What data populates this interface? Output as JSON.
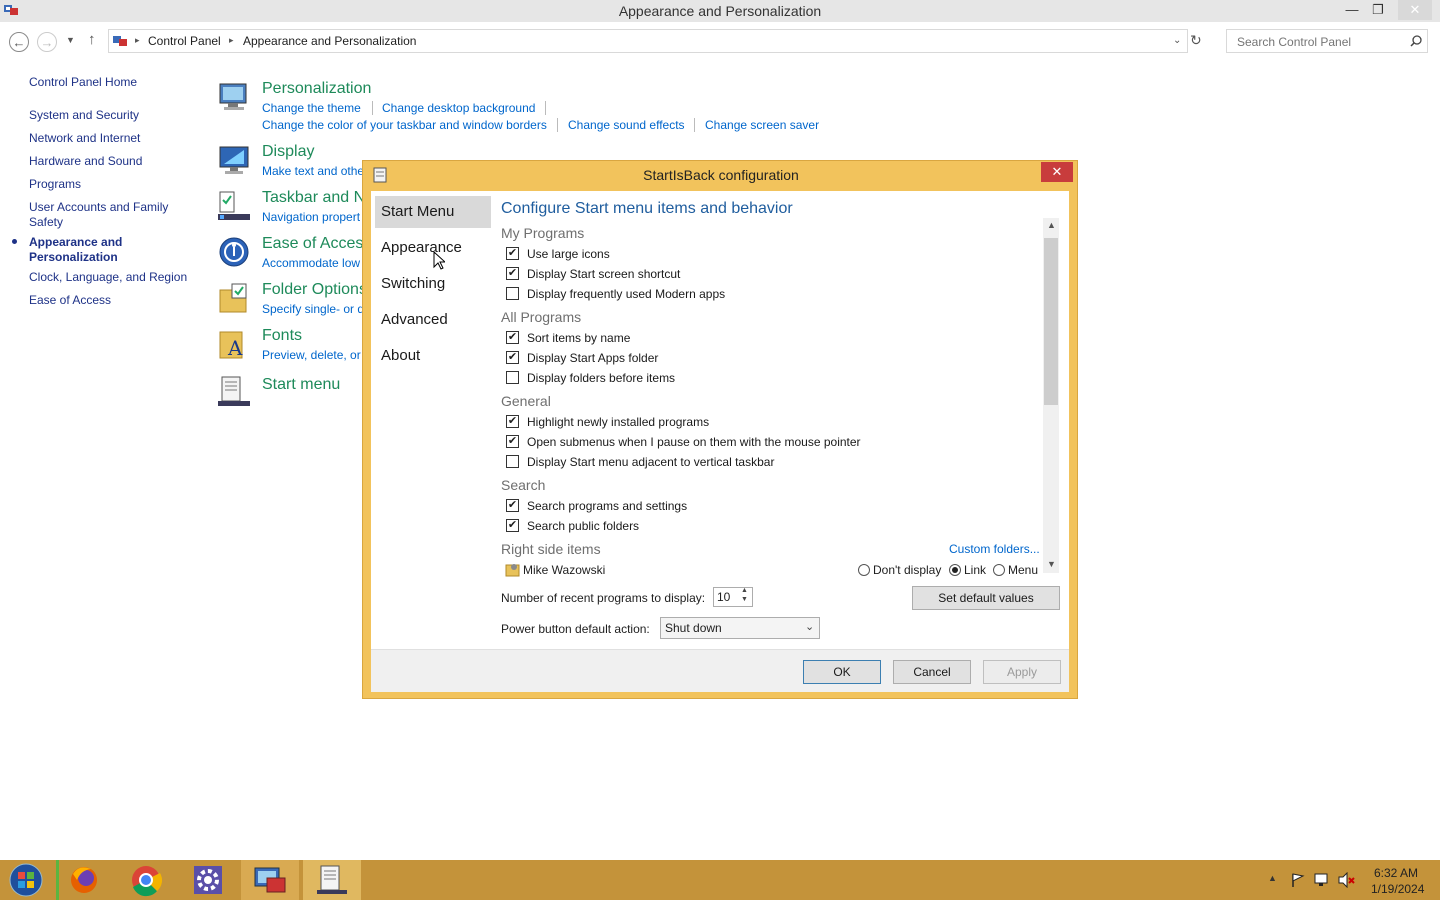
{
  "window": {
    "title": "Appearance and Personalization"
  },
  "address": {
    "breadcrumb": [
      "Control Panel",
      "Appearance and Personalization"
    ],
    "search_placeholder": "Search Control Panel"
  },
  "left_nav": {
    "home": "Control Panel Home",
    "items": [
      "System and Security",
      "Network and Internet",
      "Hardware and Sound",
      "Programs",
      "User Accounts and Family Safety",
      "Appearance and Personalization",
      "Clock, Language, and Region",
      "Ease of Access"
    ],
    "active_index": 5
  },
  "categories": [
    {
      "title": "Personalization",
      "links": [
        "Change the theme",
        "Change desktop background",
        "Change the color of your taskbar and window borders",
        "Change sound effects",
        "Change screen saver"
      ]
    },
    {
      "title": "Display",
      "links": [
        "Make text and othe"
      ]
    },
    {
      "title": "Taskbar and N",
      "links": [
        "Navigation propert"
      ]
    },
    {
      "title": "Ease of Access",
      "links": [
        "Accommodate low"
      ]
    },
    {
      "title": "Folder Options",
      "links": [
        "Specify single- or d"
      ]
    },
    {
      "title": "Fonts",
      "links": [
        "Preview, delete, or"
      ]
    },
    {
      "title": "Start menu",
      "links": []
    }
  ],
  "dialog": {
    "title": "StartIsBack configuration",
    "tabs": [
      "Start Menu",
      "Appearance",
      "Switching",
      "Advanced",
      "About"
    ],
    "active_tab": 0,
    "heading": "Configure Start menu items and behavior",
    "groups": {
      "my_programs": "My Programs",
      "all_programs": "All Programs",
      "general": "General",
      "search": "Search",
      "right_side": "Right side items"
    },
    "options": [
      {
        "label": "Use large icons",
        "checked": true
      },
      {
        "label": "Display Start screen shortcut",
        "checked": true
      },
      {
        "label": "Display frequently used Modern apps",
        "checked": false
      },
      {
        "label": "Sort items by name",
        "checked": true
      },
      {
        "label": "Display Start Apps folder",
        "checked": true
      },
      {
        "label": "Display folders before items",
        "checked": false
      },
      {
        "label": "Highlight newly installed programs",
        "checked": true
      },
      {
        "label": "Open submenus when I pause on them with the mouse pointer",
        "checked": true
      },
      {
        "label": "Display Start menu adjacent to vertical taskbar",
        "checked": false
      },
      {
        "label": "Search programs and settings",
        "checked": true
      },
      {
        "label": "Search public folders",
        "checked": true
      }
    ],
    "custom_folders": "Custom folders...",
    "right_item": {
      "label": "Mike Wazowski",
      "radios": [
        "Don't display",
        "Link",
        "Menu"
      ],
      "selected": "Link"
    },
    "recent_label": "Number of recent programs to display:",
    "recent_value": "10",
    "set_default": "Set default values",
    "power_label": "Power button default action:",
    "power_value": "Shut down",
    "buttons": {
      "ok": "OK",
      "cancel": "Cancel",
      "apply": "Apply"
    }
  },
  "taskbar": {
    "time": "6:32 AM",
    "date": "1/19/2024"
  }
}
